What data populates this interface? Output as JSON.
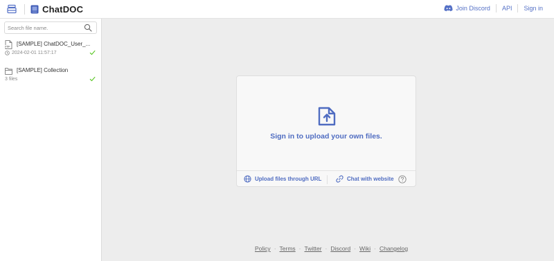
{
  "header": {
    "app_title": "ChatDOC",
    "join_discord": "Join Discord",
    "api": "API",
    "sign_in": "Sign in",
    "accent": "#5470c6"
  },
  "sidebar": {
    "search_placeholder": "Search file name.",
    "items": [
      {
        "name": "[SAMPLE] ChatDOC_User_...",
        "meta": "2024-02-01 11:57:17",
        "icon": "pdf-file-icon",
        "status": "check-icon"
      },
      {
        "name": "[SAMPLE] Collection",
        "meta": "3 files",
        "icon": "folder-icon",
        "status": "check-icon"
      }
    ]
  },
  "upload": {
    "prompt": "Sign in to upload your own files.",
    "url_action": "Upload files through URL",
    "website_action": "Chat with website",
    "accent": "#4f6cc1"
  },
  "footer_links": [
    "Policy",
    "Terms",
    "Twitter",
    "Discord",
    "Wiki",
    "Changelog"
  ]
}
